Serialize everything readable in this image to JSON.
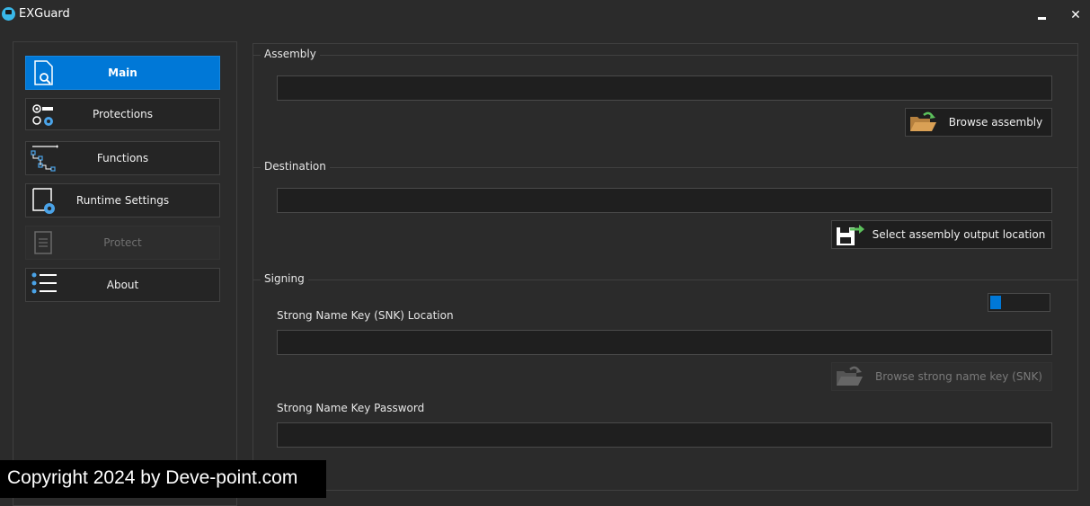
{
  "window": {
    "title": "EXGuard",
    "minimize_glyph": "▬",
    "close_glyph": "✕"
  },
  "sidebar": {
    "items": [
      {
        "label": "Main",
        "icon": "document-search-icon",
        "state": "active"
      },
      {
        "label": "Protections",
        "icon": "options-gear-icon",
        "state": "normal"
      },
      {
        "label": "Functions",
        "icon": "tree-hierarchy-icon",
        "state": "normal"
      },
      {
        "label": "Runtime Settings",
        "icon": "document-gear-icon",
        "state": "normal"
      },
      {
        "label": "Protect",
        "icon": "document-lines-icon",
        "state": "disabled"
      },
      {
        "label": "About",
        "icon": "list-icon",
        "state": "normal"
      }
    ]
  },
  "main": {
    "assembly": {
      "legend": "Assembly",
      "path_value": "",
      "browse_label": "Browse assembly",
      "browse_icon": "open-folder-arrow-icon"
    },
    "destination": {
      "legend": "Destination",
      "path_value": "",
      "select_label": "Select assembly output location",
      "select_icon": "floppy-arrow-icon"
    },
    "signing": {
      "legend": "Signing",
      "toggle_enabled": false,
      "snk_label": "Strong Name Key (SNK) Location",
      "snk_value": "",
      "snk_browse_label": "Browse strong name key (SNK)",
      "snk_browse_icon": "open-folder-arrow-icon",
      "password_label": "Strong Name Key Password",
      "password_value": ""
    }
  },
  "colors": {
    "accent": "#0078d7",
    "background": "#2b2b2b",
    "field_background": "#1f1f1f",
    "icon_blue": "#4aa3e8",
    "icon_green": "#5cc05c",
    "folder_tan": "#d9a055"
  },
  "watermark": "Copyright 2024 by Deve-point.com"
}
